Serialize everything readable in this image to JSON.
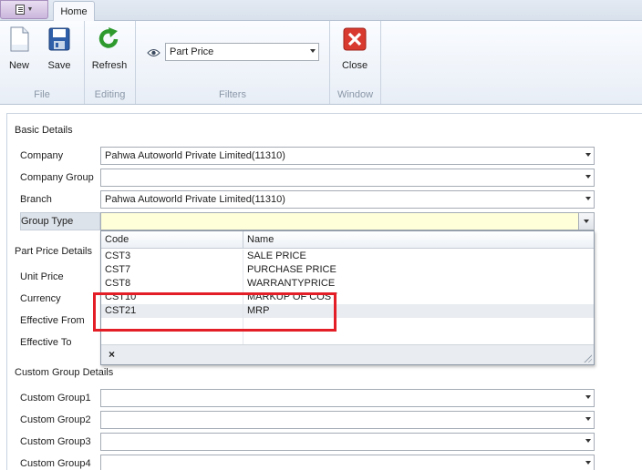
{
  "ribbon": {
    "home_tab": "Home",
    "groups": {
      "file": "File",
      "editing": "Editing",
      "filters": "Filters",
      "window": "Window"
    },
    "buttons": {
      "new": "New",
      "save": "Save",
      "refresh": "Refresh",
      "close": "Close"
    },
    "filter_value": "Part Price",
    "icons": {
      "app_menu": "menu-icon",
      "new": "new-document-icon",
      "save": "floppy-disk-icon",
      "refresh": "refresh-icon",
      "close": "close-icon",
      "filter": "eye-icon"
    }
  },
  "form": {
    "sections": {
      "basic": "Basic Details",
      "part_price": "Part Price Details",
      "custom_group": "Custom Group Details"
    },
    "fields": {
      "company": {
        "label": "Company",
        "value": "Pahwa Autoworld Private Limited(11310)"
      },
      "company_group": {
        "label": "Company Group",
        "value": ""
      },
      "branch": {
        "label": "Branch",
        "value": "Pahwa Autoworld Private Limited(11310)"
      },
      "group_type": {
        "label": "Group Type",
        "value": ""
      },
      "unit_price": {
        "label": "Unit Price"
      },
      "currency": {
        "label": "Currency"
      },
      "effective_from": {
        "label": "Effective From"
      },
      "effective_to": {
        "label": "Effective To"
      },
      "custom_group1": {
        "label": "Custom Group1",
        "value": ""
      },
      "custom_group2": {
        "label": "Custom Group2",
        "value": ""
      },
      "custom_group3": {
        "label": "Custom Group3",
        "value": ""
      },
      "custom_group4": {
        "label": "Custom Group4",
        "value": ""
      }
    }
  },
  "dropdown": {
    "columns": [
      "Code",
      "Name"
    ],
    "rows": [
      {
        "code": "CST3",
        "name": "SALE PRICE"
      },
      {
        "code": "CST7",
        "name": "PURCHASE PRICE"
      },
      {
        "code": "CST8",
        "name": "WARRANTYPRICE"
      },
      {
        "code": "CST10",
        "name": "MARKUP OF COST"
      },
      {
        "code": "CST21",
        "name": "MRP"
      }
    ],
    "selected_index": 4,
    "clear_symbol": "×"
  },
  "colors": {
    "highlight_box": "#e41e26",
    "group_type_bg": "#ffffd9"
  }
}
